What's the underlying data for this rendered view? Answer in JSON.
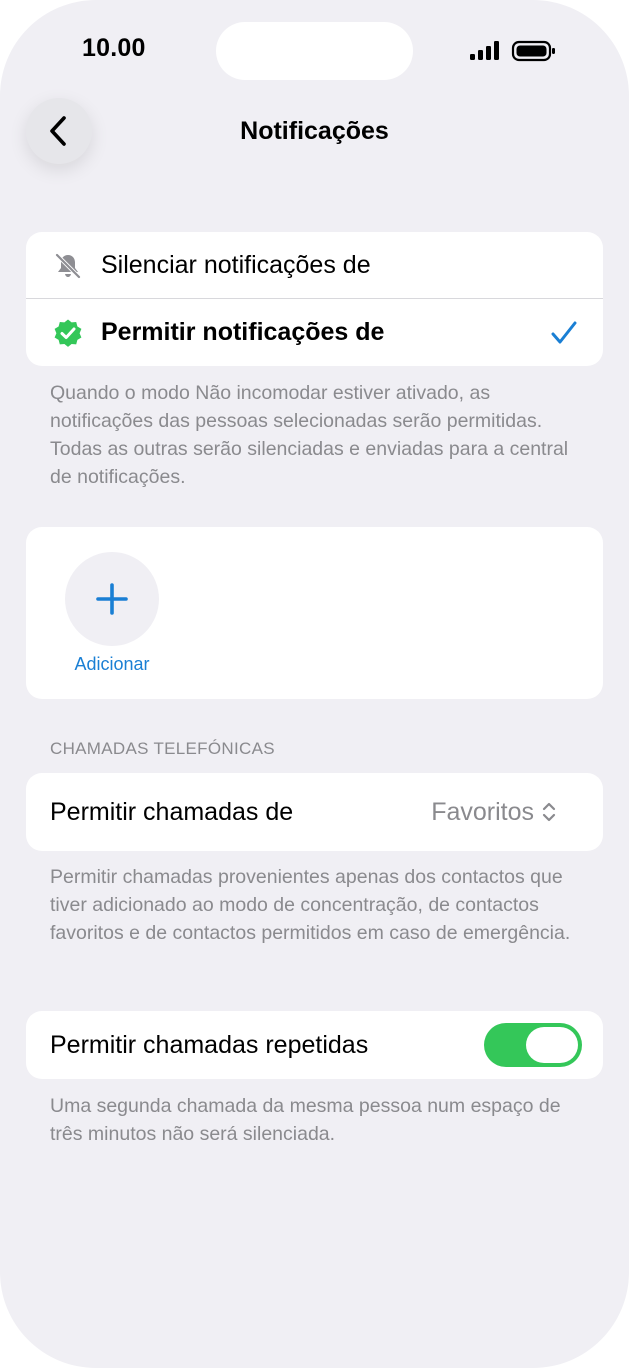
{
  "status_bar": {
    "time": "10.00"
  },
  "nav": {
    "title": "Notificações"
  },
  "notification_options": [
    {
      "label": "Silenciar notificações de",
      "icon": "bell-slash-icon",
      "selected": false
    },
    {
      "label": "Permitir notificações de",
      "icon": "checkmark-seal-icon",
      "selected": true
    }
  ],
  "notification_footnote": "Quando o modo Não incomodar estiver ativado, as notificações das pessoas selecionadas serão permitidas. Todas as outras serão silenciadas e enviadas para a central de notificações.",
  "people": {
    "add_label": "Adicionar"
  },
  "calls_section": {
    "header": "CHAMADAS TELEFÓNICAS",
    "allow_calls_label": "Permitir chamadas de",
    "allow_calls_value": "Favoritos",
    "footnote": "Permitir chamadas provenientes apenas dos contactos que tiver adicionado ao modo de concentração, de contactos favoritos e de contactos permitidos em caso de emergência."
  },
  "repeated_calls": {
    "label": "Permitir chamadas repetidas",
    "enabled": true,
    "footnote": "Uma segunda chamada da mesma pessoa num espaço de três minutos não será silenciada."
  },
  "colors": {
    "accent": "#1a7fd4",
    "toggle_on": "#34c759",
    "background": "#f0eff4"
  }
}
